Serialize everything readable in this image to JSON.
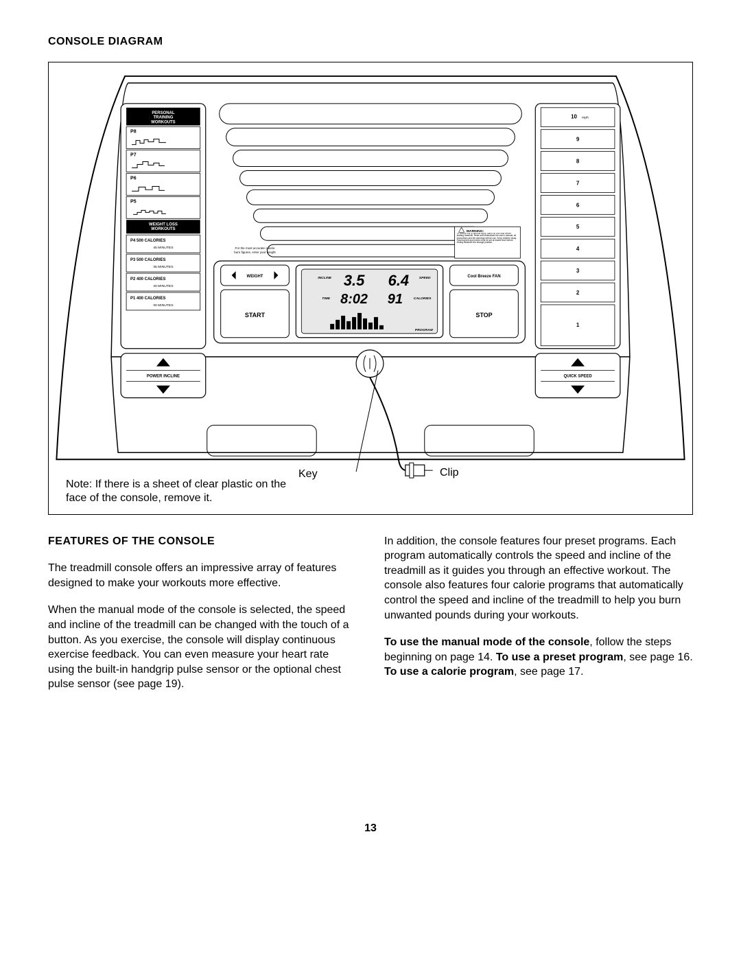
{
  "heading": "CONSOLE DIAGRAM",
  "diagram": {
    "note": "Note: If there is a sheet of clear plastic on the face of the console, remove it.",
    "key_label": "Key",
    "clip_label": "Clip",
    "left_panel": {
      "pt_title_1": "PERSONAL",
      "pt_title_2": "TRAINING",
      "pt_title_3": "WORKOUTS",
      "p8": "P8",
      "p7": "P7",
      "p6": "P6",
      "p5": "P5",
      "wl_title_1": "WEIGHT LOSS",
      "wl_title_2": "WORKOUTS",
      "p4_line": "P4  500 CALORIES",
      "p4_sub": "45 MINUTES",
      "p3_line": "P3  500 CALORIES",
      "p3_sub": "35 MINUTES",
      "p2_line": "P2  400 CALORIES",
      "p2_sub": "40 MINUTES",
      "p1_line": "P1  400 CALORIES",
      "p1_sub": "30 MINUTES",
      "incline_label": "POWER INCLINE"
    },
    "right_panel": {
      "s10": "10",
      "s10_unit": "mph",
      "s9": "9",
      "s8": "8",
      "s7": "7",
      "s6": "6",
      "s5": "5",
      "s4": "4",
      "s3": "3",
      "s2": "2",
      "s1": "1",
      "speed_label": "QUICK SPEED"
    },
    "center": {
      "weight_btn": "WEIGHT",
      "weight_note_1": "For the most accurate calorie",
      "weight_note_2": "burn figures, enter your weight",
      "start_btn": "START",
      "stop_btn": "STOP",
      "fan_btn": "Cool Breeze FAN",
      "warning_title": "WARNING:",
      "warning_body": "To reduce risk of serious injury, stand on foot rails before starting treadmill. Read and understand the user's manual, all instructions and the warnings before use. Keep children away. Running belt and incline must be set at lowest level before folding treadmill into storage position.",
      "disp_incline_lbl": "INCLINE",
      "disp_incline_val": "3.5",
      "disp_speed_lbl": "SPEED",
      "disp_speed_val": "6.4",
      "disp_time_lbl": "TIME",
      "disp_time_val": "8:02",
      "disp_cal_lbl": "CALORIES",
      "disp_cal_val": "91",
      "disp_program_lbl": "PROGRAM"
    }
  },
  "features_heading": "FEATURES OF THE CONSOLE",
  "col1_p1": "The treadmill console offers an impressive array of features designed to make your workouts more effective.",
  "col1_p2": "When the manual mode of the console is selected, the speed and incline of the treadmill can be changed with the touch of a button. As you exercise, the console will display continuous exercise feedback. You can even measure your heart rate using the built-in handgrip pulse sensor or the optional chest pulse sensor (see page 19).",
  "col2_p1": "In addition, the console features four preset programs. Each program automatically controls the speed and incline of the treadmill as it guides you through an effective workout. The console also features four calorie programs that automatically control the speed and incline of the treadmill to help you burn unwanted pounds during your workouts.",
  "col2_p2_b1": "To use the manual mode of the console",
  "col2_p2_t1": ", follow the steps beginning on page 14. ",
  "col2_p2_b2": "To use a preset program",
  "col2_p2_t2": ", see page 16. ",
  "col2_p2_b3": "To use a calorie program",
  "col2_p2_t3": ", see page 17.",
  "page_number": "13"
}
